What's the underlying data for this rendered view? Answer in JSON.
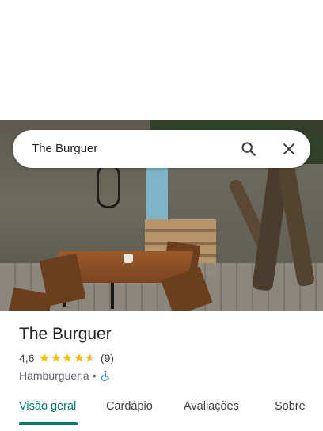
{
  "search": {
    "query": "The Burguer"
  },
  "place": {
    "name": "The Burguer",
    "rating": "4,6",
    "rating_value": 4.6,
    "review_count": "(9)",
    "category": "Hamburgueria",
    "separator": "•",
    "accessibility_icon": "wheelchair-icon"
  },
  "tabs": [
    {
      "label": "Visão geral",
      "active": true
    },
    {
      "label": "Cardápio",
      "active": false
    },
    {
      "label": "Avaliações",
      "active": false
    },
    {
      "label": "Sobre",
      "active": false
    }
  ],
  "colors": {
    "accent": "#00796b",
    "star": "#fbbc04",
    "access": "#1a73e8"
  }
}
